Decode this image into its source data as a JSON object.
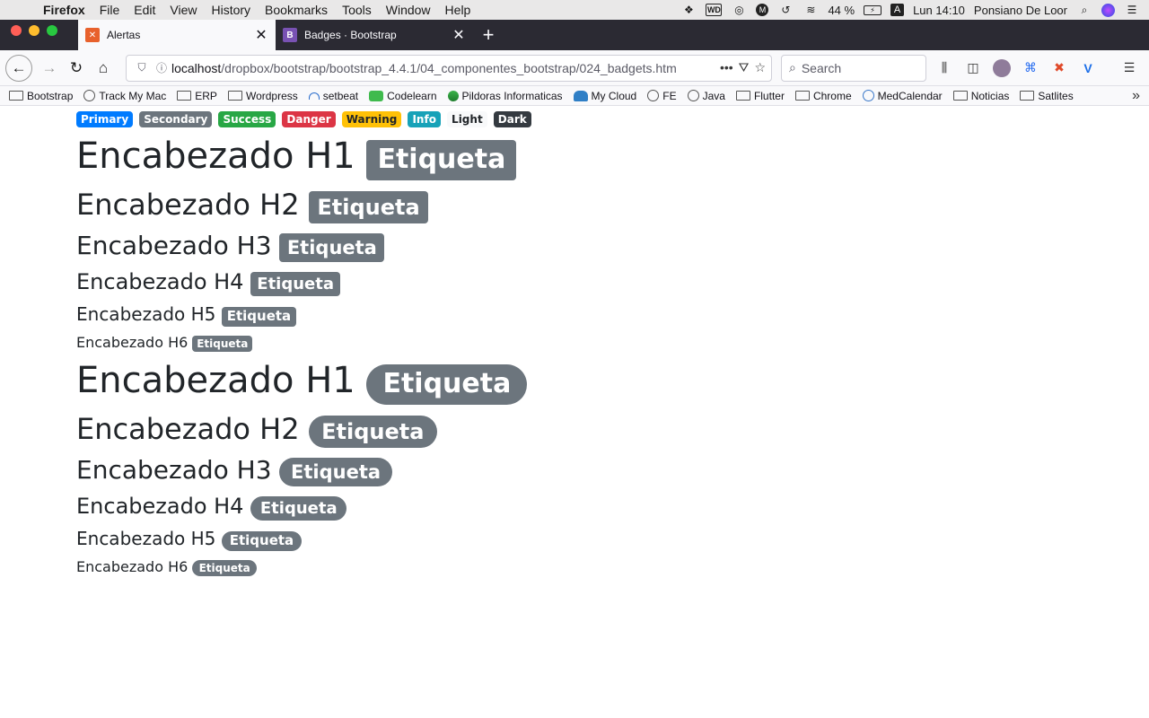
{
  "menubar": {
    "app": "Firefox",
    "items": [
      "File",
      "Edit",
      "View",
      "History",
      "Bookmarks",
      "Tools",
      "Window",
      "Help"
    ],
    "battery": "44 %",
    "input_source": "A",
    "clock": "Lun 14:10",
    "user": "Ponsiano De Loor"
  },
  "tabs": [
    {
      "title": "Alertas",
      "favicon_color": "#e8612c",
      "favicon_letter": "X"
    },
    {
      "title": "Badges · Bootstrap",
      "favicon_color": "#7952b3",
      "favicon_letter": "B"
    }
  ],
  "navbar": {
    "url_host": "localhost",
    "url_path": "/dropbox/bootstrap/bootstrap_4.4.1/04_componentes_bootstrap/024_badgets.htm",
    "search_placeholder": "Search"
  },
  "bookmarks": [
    {
      "label": "Bootstrap",
      "icon": "folder"
    },
    {
      "label": "Track My Mac",
      "icon": "globe"
    },
    {
      "label": "ERP",
      "icon": "folder"
    },
    {
      "label": "Wordpress",
      "icon": "folder"
    },
    {
      "label": "setbeat",
      "icon": "setbeat"
    },
    {
      "label": "Codelearn",
      "icon": "green"
    },
    {
      "label": "Pildoras Informaticas",
      "icon": "pildoras"
    },
    {
      "label": "My Cloud",
      "icon": "cloud"
    },
    {
      "label": "FE",
      "icon": "globe"
    },
    {
      "label": "Java",
      "icon": "globe"
    },
    {
      "label": "Flutter",
      "icon": "folder"
    },
    {
      "label": "Chrome",
      "icon": "folder"
    },
    {
      "label": "MedCalendar",
      "icon": "who"
    },
    {
      "label": "Noticias",
      "icon": "folder"
    },
    {
      "label": "Satlites",
      "icon": "folder"
    }
  ],
  "page": {
    "badges": [
      "Primary",
      "Secondary",
      "Success",
      "Danger",
      "Warning",
      "Info",
      "Light",
      "Dark"
    ],
    "headings": [
      "Encabezado H1",
      "Encabezado H2",
      "Encabezado H3",
      "Encabezado H4",
      "Encabezado H5",
      "Encabezado H6"
    ],
    "badge_label": "Etiqueta"
  }
}
